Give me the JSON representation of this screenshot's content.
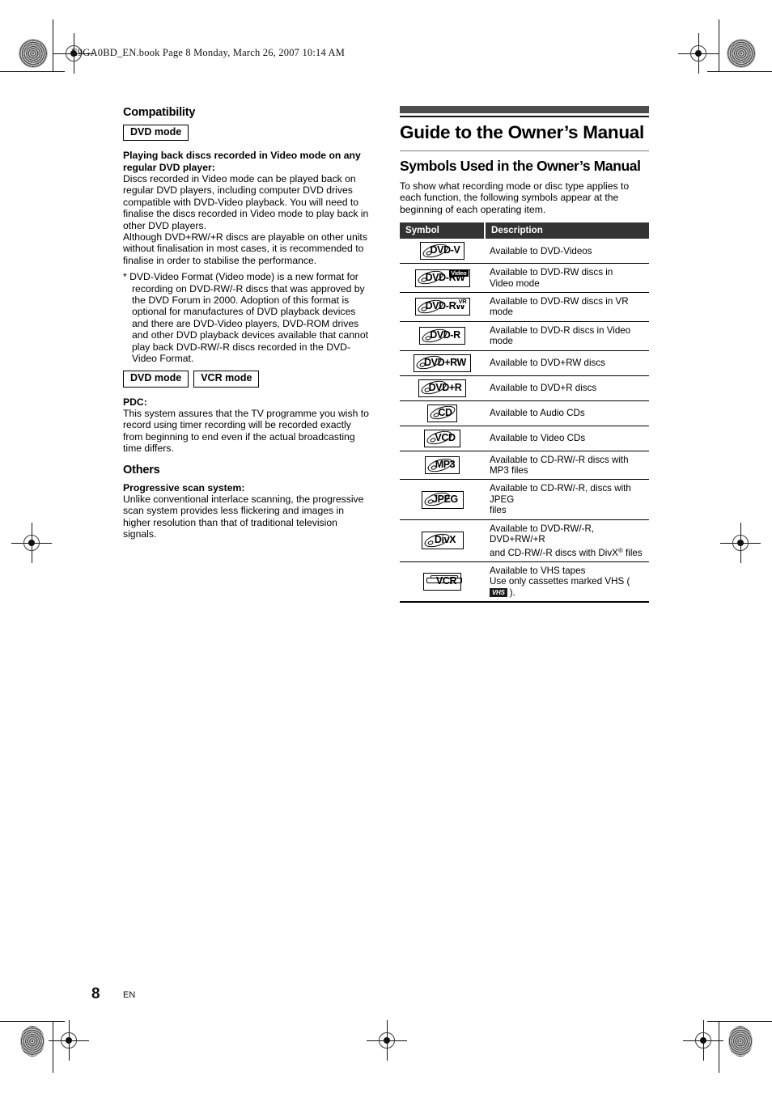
{
  "header": {
    "book_line": "E9GA0BD_EN.book  Page 8  Monday, March 26, 2007  10:14 AM"
  },
  "footer": {
    "page_number": "8",
    "language": "EN"
  },
  "left_column": {
    "section_title": "Compatibility",
    "mode_badge_1": "DVD mode",
    "subhead_1": "Playing back discs recorded in Video mode on any regular DVD player:",
    "para_1": "Discs recorded in Video mode can be played back on regular DVD players, including computer DVD drives compatible with DVD-Video playback. You will need to finalise the discs recorded in Video mode to play back in other DVD players.",
    "para_2": "Although DVD+RW/+R discs are playable on other units without finalisation in most cases, it is recommended to finalise in order to stabilise the performance.",
    "footnote": "* DVD-Video Format (Video mode) is a new format for recording on DVD-RW/-R discs that was approved by the DVD Forum in 2000. Adoption of this format is optional for manufactures of DVD playback devices and there are DVD-Video players, DVD-ROM drives and other DVD playback devices available that cannot play back DVD-RW/-R discs recorded in the DVD-Video Format.",
    "mode_badge_2": "DVD mode",
    "mode_badge_3": "VCR mode",
    "subhead_2": "PDC:",
    "para_3": "This system assures that the TV programme you wish to record using timer recording will be recorded exactly from beginning to end even if the actual broadcasting time differs.",
    "section_title_2": "Others",
    "subhead_3": "Progressive scan system:",
    "para_4": "Unlike conventional interlace scanning, the progressive scan system provides less flickering and images in higher resolution than that of traditional television signals."
  },
  "right_column": {
    "chapter_title": "Guide to the Owner’s Manual",
    "section_title": "Symbols Used in the Owner’s Manual",
    "intro": "To show what recording mode or disc type applies to each function, the following symbols appear at the beginning of each operating item.",
    "table": {
      "headers": [
        "Symbol",
        "Description"
      ],
      "rows": [
        {
          "symbol_label": "DVD-V",
          "symbol_tag": "",
          "symbol_tag_style": "",
          "symbol_kind": "disc",
          "description": "Available to DVD-Videos"
        },
        {
          "symbol_label": "DVD-RW",
          "symbol_tag": "Video",
          "symbol_tag_style": "dark",
          "symbol_kind": "disc",
          "description": "Available to DVD-RW discs in\nVideo mode"
        },
        {
          "symbol_label": "DVD-RW",
          "symbol_tag": "VR",
          "symbol_tag_style": "light",
          "symbol_kind": "disc",
          "description": "Available to DVD-RW discs in VR mode"
        },
        {
          "symbol_label": "DVD-R",
          "symbol_tag": "",
          "symbol_tag_style": "",
          "symbol_kind": "disc",
          "description": "Available to DVD-R discs in Video mode"
        },
        {
          "symbol_label": "DVD+RW",
          "symbol_tag": "",
          "symbol_tag_style": "",
          "symbol_kind": "disc",
          "description": "Available to DVD+RW discs"
        },
        {
          "symbol_label": "DVD+R",
          "symbol_tag": "",
          "symbol_tag_style": "",
          "symbol_kind": "disc",
          "description": "Available to DVD+R discs"
        },
        {
          "symbol_label": "CD",
          "symbol_tag": "",
          "symbol_tag_style": "",
          "symbol_kind": "disc",
          "description": "Available to Audio CDs"
        },
        {
          "symbol_label": "VCD",
          "symbol_tag": "",
          "symbol_tag_style": "",
          "symbol_kind": "disc",
          "description": "Available to Video CDs"
        },
        {
          "symbol_label": "MP3",
          "symbol_tag": "",
          "symbol_tag_style": "",
          "symbol_kind": "disc",
          "description": "Available to CD-RW/-R discs with\nMP3 files"
        },
        {
          "symbol_label": "JPEG",
          "symbol_tag": "",
          "symbol_tag_style": "",
          "symbol_kind": "disc",
          "description": "Available to CD-RW/-R, discs with JPEG\nfiles"
        },
        {
          "symbol_label": "DivX",
          "symbol_tag": "",
          "symbol_tag_style": "",
          "symbol_kind": "disc",
          "description": "Available to DVD-RW/-R, DVD+RW/+R\nand CD-RW/-R discs with DivX® files"
        },
        {
          "symbol_label": "VCR",
          "symbol_tag": "",
          "symbol_tag_style": "",
          "symbol_kind": "cassette",
          "description": "Available to VHS tapes\nUse only cassettes marked VHS (  ).",
          "vhs_logo": "VHS"
        }
      ]
    }
  }
}
